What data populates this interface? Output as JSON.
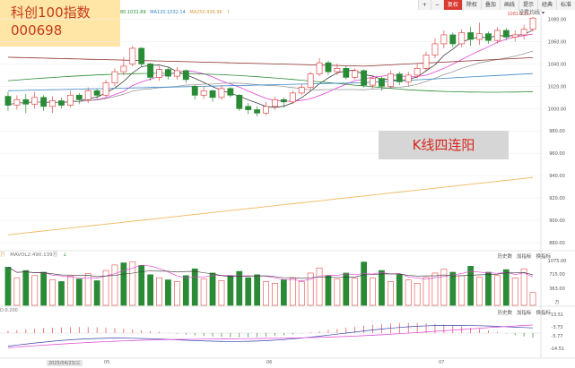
{
  "toolbar": {
    "items": [
      "+",
      "−",
      "复权",
      "除权",
      "叠加",
      "画线",
      "提示",
      "经典",
      "标准"
    ],
    "active_index": 2,
    "settings_label": "设置均线"
  },
  "title": {
    "line1": "科创100指数",
    "line2": "000698"
  },
  "ma_legend": [
    "80.1031.89",
    "MA120.1032.14",
    "MA250.936.96"
  ],
  "annotation": "K线四连阳",
  "volume_panel": {
    "labels": [
      "万",
      "MAVOL2:490.139万"
    ],
    "tabs": [
      "历史数",
      "加指标",
      "换指标"
    ],
    "axis_labels": [
      "1075.00",
      "715.00",
      "363.00",
      "万"
    ]
  },
  "macd_panel": {
    "label": "D:0.200",
    "tabs": [
      "历史数",
      "加指标",
      "换指标"
    ],
    "axis_labels": [
      "13.51",
      "-3.73",
      "-5.77",
      "-14.51"
    ]
  },
  "date_axis": {
    "cursor_label": "2025/04/23/三",
    "month_labels": [
      "05",
      "06",
      "07"
    ]
  },
  "colors": {
    "up": "#e14a4a",
    "down": "#2a8a35",
    "ma5": "#222222",
    "ma10": "#e23fd5",
    "ma20": "#999999",
    "ma30": "#8b2a2a",
    "ma60": "#2a8a35",
    "ma120": "#3a88c8",
    "ma250": "#f0b860"
  },
  "chart_data": {
    "type": "candlestick",
    "price_axis": {
      "ticks": [
        1080,
        1060,
        1040,
        1020,
        1000,
        980,
        960,
        940,
        920,
        900,
        880
      ],
      "ylim": [
        876,
        1086
      ]
    },
    "last_price_label": "1081.13",
    "candles": [
      {
        "o": 1011,
        "c": 1003,
        "h": 1015,
        "l": 998
      },
      {
        "o": 1003,
        "c": 1008,
        "h": 1012,
        "l": 999
      },
      {
        "o": 1008,
        "c": 1004,
        "h": 1013,
        "l": 996
      },
      {
        "o": 1004,
        "c": 1010,
        "h": 1015,
        "l": 1000
      },
      {
        "o": 1010,
        "c": 1002,
        "h": 1012,
        "l": 998
      },
      {
        "o": 1002,
        "c": 1007,
        "h": 1011,
        "l": 996
      },
      {
        "o": 1007,
        "c": 1003,
        "h": 1010,
        "l": 1000
      },
      {
        "o": 1003,
        "c": 1012,
        "h": 1016,
        "l": 1001
      },
      {
        "o": 1012,
        "c": 1008,
        "h": 1014,
        "l": 1004
      },
      {
        "o": 1008,
        "c": 1016,
        "h": 1019,
        "l": 1005
      },
      {
        "o": 1016,
        "c": 1012,
        "h": 1018,
        "l": 1009
      },
      {
        "o": 1012,
        "c": 1023,
        "h": 1026,
        "l": 1010
      },
      {
        "o": 1023,
        "c": 1033,
        "h": 1036,
        "l": 1020
      },
      {
        "o": 1033,
        "c": 1038,
        "h": 1046,
        "l": 1030
      },
      {
        "o": 1040,
        "c": 1054,
        "h": 1056,
        "l": 1038
      },
      {
        "o": 1054,
        "c": 1040,
        "h": 1055,
        "l": 1037
      },
      {
        "o": 1040,
        "c": 1028,
        "h": 1041,
        "l": 1025
      },
      {
        "o": 1028,
        "c": 1035,
        "h": 1038,
        "l": 1025
      },
      {
        "o": 1035,
        "c": 1029,
        "h": 1037,
        "l": 1026
      },
      {
        "o": 1029,
        "c": 1034,
        "h": 1037,
        "l": 1026
      },
      {
        "o": 1034,
        "c": 1026,
        "h": 1035,
        "l": 1023
      },
      {
        "o": 1020,
        "c": 1012,
        "h": 1021,
        "l": 1008
      },
      {
        "o": 1012,
        "c": 1016,
        "h": 1020,
        "l": 1009
      },
      {
        "o": 1016,
        "c": 1010,
        "h": 1017,
        "l": 1006
      },
      {
        "o": 1010,
        "c": 1018,
        "h": 1021,
        "l": 1008
      },
      {
        "o": 1018,
        "c": 1012,
        "h": 1019,
        "l": 1010
      },
      {
        "o": 1012,
        "c": 1000,
        "h": 1013,
        "l": 998
      },
      {
        "o": 1002,
        "c": 999,
        "h": 1005,
        "l": 995
      },
      {
        "o": 999,
        "c": 996,
        "h": 1002,
        "l": 993
      },
      {
        "o": 996,
        "c": 1002,
        "h": 1006,
        "l": 994
      },
      {
        "o": 1002,
        "c": 1008,
        "h": 1011,
        "l": 999
      },
      {
        "o": 1008,
        "c": 1006,
        "h": 1010,
        "l": 1001
      },
      {
        "o": 1006,
        "c": 1014,
        "h": 1016,
        "l": 1004
      },
      {
        "o": 1014,
        "c": 1019,
        "h": 1022,
        "l": 1012
      },
      {
        "o": 1019,
        "c": 1031,
        "h": 1033,
        "l": 1017
      },
      {
        "o": 1031,
        "c": 1041,
        "h": 1045,
        "l": 1029
      },
      {
        "o": 1041,
        "c": 1033,
        "h": 1043,
        "l": 1030
      },
      {
        "o": 1033,
        "c": 1036,
        "h": 1040,
        "l": 1030
      },
      {
        "o": 1036,
        "c": 1028,
        "h": 1038,
        "l": 1026
      },
      {
        "o": 1028,
        "c": 1034,
        "h": 1036,
        "l": 1026
      },
      {
        "o": 1034,
        "c": 1021,
        "h": 1035,
        "l": 1019
      },
      {
        "o": 1021,
        "c": 1027,
        "h": 1029,
        "l": 1018
      },
      {
        "o": 1027,
        "c": 1020,
        "h": 1029,
        "l": 1016
      },
      {
        "o": 1020,
        "c": 1031,
        "h": 1034,
        "l": 1018
      },
      {
        "o": 1031,
        "c": 1024,
        "h": 1033,
        "l": 1021
      },
      {
        "o": 1024,
        "c": 1030,
        "h": 1033,
        "l": 1020
      },
      {
        "o": 1030,
        "c": 1036,
        "h": 1040,
        "l": 1027
      },
      {
        "o": 1036,
        "c": 1048,
        "h": 1051,
        "l": 1033
      },
      {
        "o": 1048,
        "c": 1058,
        "h": 1063,
        "l": 1045
      },
      {
        "o": 1058,
        "c": 1066,
        "h": 1070,
        "l": 1054
      },
      {
        "o": 1066,
        "c": 1058,
        "h": 1068,
        "l": 1055
      },
      {
        "o": 1058,
        "c": 1068,
        "h": 1071,
        "l": 1055
      },
      {
        "o": 1068,
        "c": 1062,
        "h": 1073,
        "l": 1056
      },
      {
        "o": 1062,
        "c": 1067,
        "h": 1077,
        "l": 1057
      },
      {
        "o": 1067,
        "c": 1061,
        "h": 1069,
        "l": 1058
      },
      {
        "o": 1061,
        "c": 1070,
        "h": 1073,
        "l": 1058
      },
      {
        "o": 1070,
        "c": 1064,
        "h": 1072,
        "l": 1061
      },
      {
        "o": 1064,
        "c": 1066,
        "h": 1070,
        "l": 1060
      },
      {
        "o": 1066,
        "c": 1071,
        "h": 1075,
        "l": 1062
      },
      {
        "o": 1071,
        "c": 1081,
        "h": 1082,
        "l": 1069
      }
    ],
    "volume": [
      {
        "v": 900,
        "up": false
      },
      {
        "v": 650,
        "up": true
      },
      {
        "v": 820,
        "up": false
      },
      {
        "v": 700,
        "up": true
      },
      {
        "v": 780,
        "up": false
      },
      {
        "v": 600,
        "up": true
      },
      {
        "v": 560,
        "up": false
      },
      {
        "v": 690,
        "up": true
      },
      {
        "v": 620,
        "up": false
      },
      {
        "v": 750,
        "up": true
      },
      {
        "v": 580,
        "up": false
      },
      {
        "v": 820,
        "up": true
      },
      {
        "v": 950,
        "up": true
      },
      {
        "v": 1000,
        "up": false
      },
      {
        "v": 1020,
        "up": true
      },
      {
        "v": 940,
        "up": false
      },
      {
        "v": 720,
        "up": false
      },
      {
        "v": 650,
        "up": true
      },
      {
        "v": 600,
        "up": false
      },
      {
        "v": 560,
        "up": true
      },
      {
        "v": 700,
        "up": false
      },
      {
        "v": 860,
        "up": false
      },
      {
        "v": 620,
        "up": true
      },
      {
        "v": 760,
        "up": false
      },
      {
        "v": 580,
        "up": true
      },
      {
        "v": 700,
        "up": false
      },
      {
        "v": 800,
        "up": false
      },
      {
        "v": 650,
        "up": false
      },
      {
        "v": 720,
        "up": false
      },
      {
        "v": 560,
        "up": true
      },
      {
        "v": 520,
        "up": true
      },
      {
        "v": 600,
        "up": false
      },
      {
        "v": 640,
        "up": true
      },
      {
        "v": 560,
        "up": true
      },
      {
        "v": 760,
        "up": true
      },
      {
        "v": 880,
        "up": true
      },
      {
        "v": 700,
        "up": false
      },
      {
        "v": 620,
        "up": true
      },
      {
        "v": 760,
        "up": false
      },
      {
        "v": 640,
        "up": true
      },
      {
        "v": 1020,
        "up": false
      },
      {
        "v": 640,
        "up": true
      },
      {
        "v": 820,
        "up": false
      },
      {
        "v": 560,
        "up": true
      },
      {
        "v": 720,
        "up": false
      },
      {
        "v": 600,
        "up": true
      },
      {
        "v": 520,
        "up": true
      },
      {
        "v": 660,
        "up": true
      },
      {
        "v": 760,
        "up": true
      },
      {
        "v": 850,
        "up": true
      },
      {
        "v": 780,
        "up": false
      },
      {
        "v": 700,
        "up": true
      },
      {
        "v": 920,
        "up": false
      },
      {
        "v": 660,
        "up": true
      },
      {
        "v": 780,
        "up": false
      },
      {
        "v": 700,
        "up": true
      },
      {
        "v": 840,
        "up": false
      },
      {
        "v": 640,
        "up": true
      },
      {
        "v": 860,
        "up": true
      },
      {
        "v": 300,
        "up": true
      }
    ],
    "volume_ylim": [
      0,
      1075
    ],
    "macd_ylim": [
      -16,
      16
    ]
  }
}
